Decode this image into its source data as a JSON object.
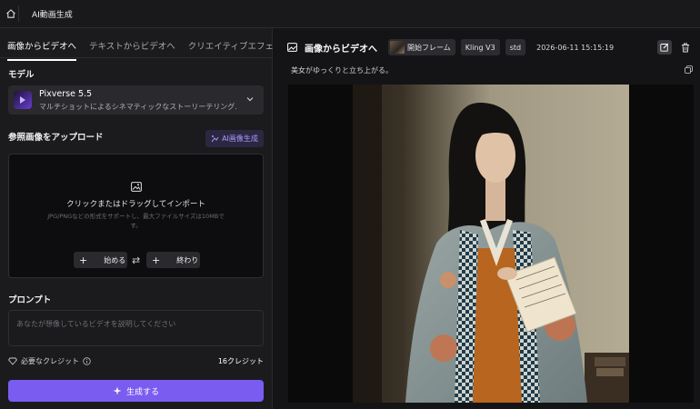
{
  "app": {
    "title": "AI動画生成"
  },
  "left": {
    "tabs": [
      {
        "label": "画像からビデオへ",
        "active": true
      },
      {
        "label": "テキストからビデオへ",
        "active": false
      },
      {
        "label": "クリエイティブエフェクト",
        "active": false
      }
    ],
    "model_section": "モデル",
    "model": {
      "name": "Pixverse 5.5",
      "description": "マルチショットによるシネマティックなストーリーテリング."
    },
    "upload_section": "参照画像をアップロード",
    "ai_image_button": "AI画像生成",
    "upload": {
      "title": "クリックまたはドラッグしてインポート",
      "hint": "JPG/PNGなどの形式をサポートし、最大ファイルサイズは10MBです。",
      "start_label": "始める",
      "end_label": "終わり"
    },
    "prompt_section": "プロンプト",
    "prompt_placeholder": "あなたが想像しているビデオを説明してください",
    "credits": {
      "label": "必要なクレジット",
      "amount": "16クレジット"
    },
    "generate_button": "生成する"
  },
  "right": {
    "title": "画像からビデオへ",
    "chips": {
      "start_frame": "開始フレーム",
      "model": "Kling V3",
      "quality": "std"
    },
    "timestamp": "2026-06-11 15:15:19",
    "prompt_text": "美女がゆっくりと立ち上がる。"
  },
  "colors": {
    "accent": "#7b5cf0",
    "ai_button_text": "#a99bff",
    "background": "#131316",
    "panel": "#1b1b1e"
  }
}
